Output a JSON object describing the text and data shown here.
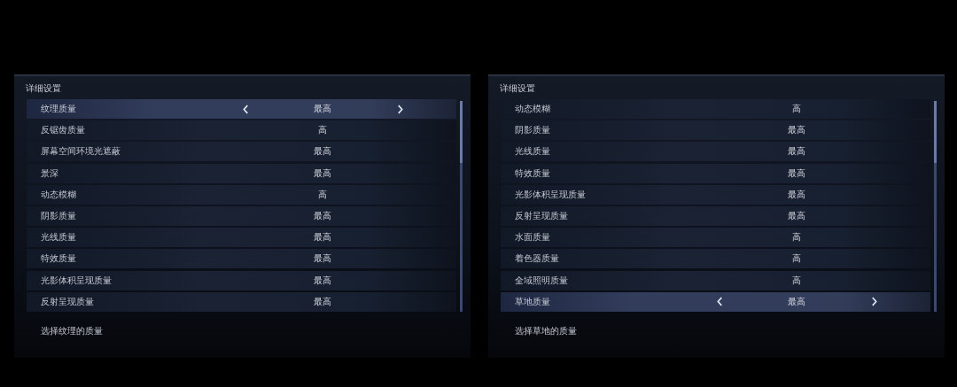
{
  "panels": [
    {
      "title": "详细设置",
      "description": "选择纹理的质量",
      "settings": [
        {
          "label": "纹理质量",
          "value": "最高",
          "selected": true
        },
        {
          "label": "反锯齿质量",
          "value": "高",
          "selected": false
        },
        {
          "label": "屏幕空间环境光遮蔽",
          "value": "最高",
          "selected": false
        },
        {
          "label": "景深",
          "value": "最高",
          "selected": false
        },
        {
          "label": "动态模糊",
          "value": "高",
          "selected": false
        },
        {
          "label": "阴影质量",
          "value": "最高",
          "selected": false
        },
        {
          "label": "光线质量",
          "value": "最高",
          "selected": false
        },
        {
          "label": "特效质量",
          "value": "最高",
          "selected": false
        },
        {
          "label": "光影体积呈现质量",
          "value": "最高",
          "selected": false
        },
        {
          "label": "反射呈现质量",
          "value": "最高",
          "selected": false
        }
      ]
    },
    {
      "title": "详细设置",
      "description": "选择草地的质量",
      "settings": [
        {
          "label": "动态模糊",
          "value": "高",
          "selected": false
        },
        {
          "label": "阴影质量",
          "value": "最高",
          "selected": false
        },
        {
          "label": "光线质量",
          "value": "最高",
          "selected": false
        },
        {
          "label": "特效质量",
          "value": "最高",
          "selected": false
        },
        {
          "label": "光影体积呈现质量",
          "value": "最高",
          "selected": false
        },
        {
          "label": "反射呈现质量",
          "value": "最高",
          "selected": false
        },
        {
          "label": "水面质量",
          "value": "高",
          "selected": false
        },
        {
          "label": "着色器质量",
          "value": "高",
          "selected": false
        },
        {
          "label": "全域照明质量",
          "value": "高",
          "selected": false
        },
        {
          "label": "草地质量",
          "value": "最高",
          "selected": true
        }
      ]
    }
  ]
}
